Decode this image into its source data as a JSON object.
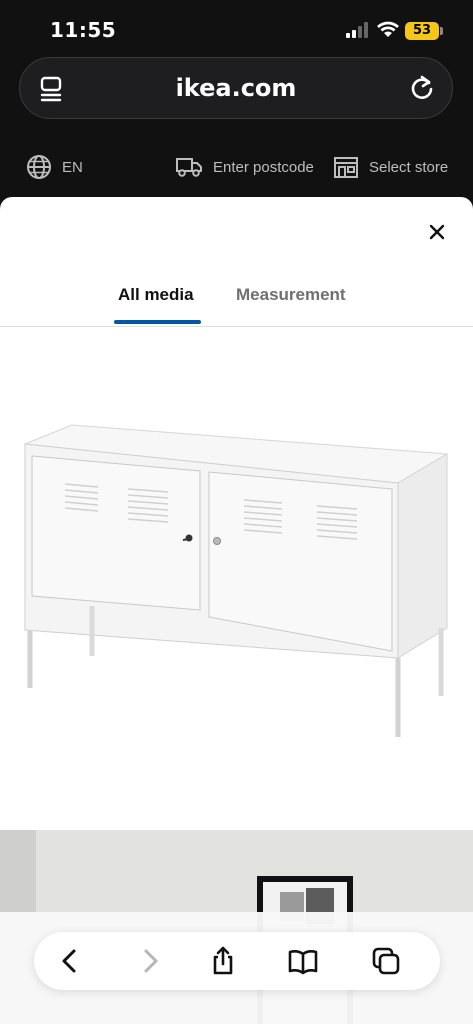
{
  "status_bar": {
    "time": "11:55",
    "battery": "53",
    "battery_color": "#f5c518"
  },
  "browser": {
    "url": "ikea.com",
    "tabs_icon": "tabs-list-icon",
    "reload_icon": "reload-icon"
  },
  "site_strip": {
    "language": "EN",
    "postcode": "Enter postcode",
    "store": "Select store"
  },
  "modal": {
    "tabs": [
      {
        "label": "All media",
        "active": true
      },
      {
        "label": "Measurement",
        "active": false
      }
    ],
    "accent": "#0058a3"
  },
  "toolbar": {
    "buttons": [
      "back-icon",
      "forward-icon",
      "share-icon",
      "bookmarks-icon",
      "tabs-icon"
    ]
  }
}
